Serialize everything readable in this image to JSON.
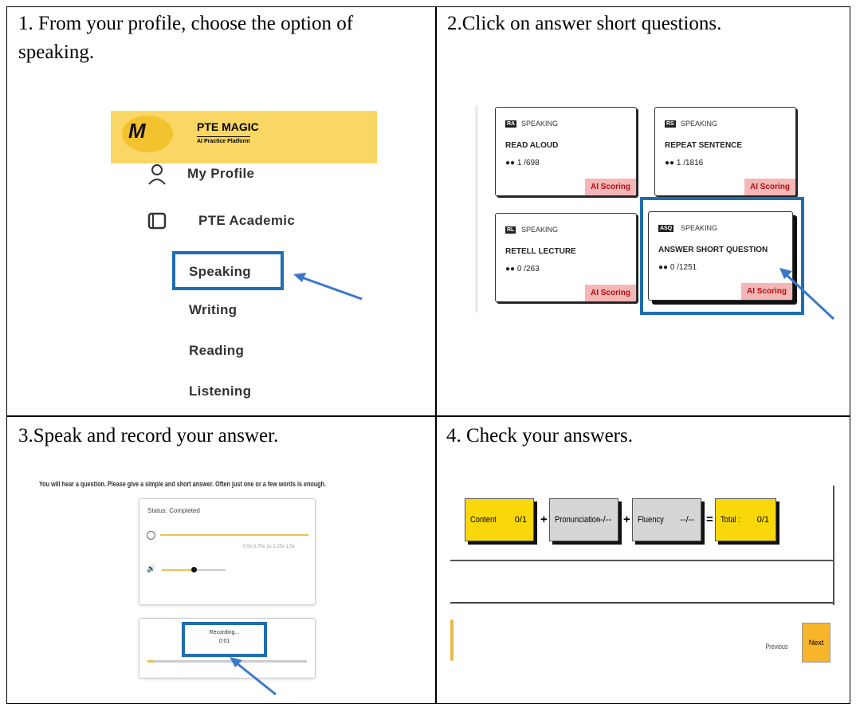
{
  "steps": [
    "1. From your profile, choose the option of speaking.",
    "2.Click on answer short questions.",
    "3.Speak and record your answer.",
    "4. Check your answers."
  ],
  "sidebar": {
    "brand": "PTE MAGIC",
    "brand_sub": "AI Practice Platform",
    "logo_letter": "M",
    "profile": "My Profile",
    "academic": "PTE Academic",
    "items": [
      "Speaking",
      "Writing",
      "Reading",
      "Listening"
    ]
  },
  "cards": [
    {
      "badge": "RA",
      "skill": "SPEAKING",
      "title": "READ ALOUD",
      "count": "●● 1 /698",
      "ai": "AI Scoring"
    },
    {
      "badge": "RS",
      "skill": "SPEAKING",
      "title": "REPEAT SENTENCE",
      "count": "●● 1 /1816",
      "ai": "AI Scoring"
    },
    {
      "badge": "RL",
      "skill": "SPEAKING",
      "title": "RETELL LECTURE",
      "count": "●● 0 /263",
      "ai": "AI Scoring"
    },
    {
      "badge": "ASQ",
      "skill": "SPEAKING",
      "title": "ANSWER SHORT QUESTION",
      "count": "●● 0 /1251",
      "ai": "AI Scoring"
    }
  ],
  "recorder": {
    "instruction": "You will hear a question. Please give a simple and short answer. Often just one or a few words is enough.",
    "status": "Status: Completed",
    "speeds": "0.5x  0.75x  1x  1.25x  1.5x",
    "recording": "Recording...",
    "time": "0:01"
  },
  "scores": {
    "content_label": "Content",
    "content_val": "0/1",
    "pron_label": "Pronunciation",
    "pron_val": "--/--",
    "fluency_label": "Fluency",
    "fluency_val": "--/--",
    "total_label": "Total :",
    "total_val": "0/1",
    "plus": "+",
    "equals": "=",
    "prev": "Previous",
    "next": "Next"
  },
  "colors": {
    "highlight": "#1f6db1",
    "yellow": "#f9d80b",
    "banner": "#fad665",
    "ai_bg": "#f4b6b6"
  }
}
